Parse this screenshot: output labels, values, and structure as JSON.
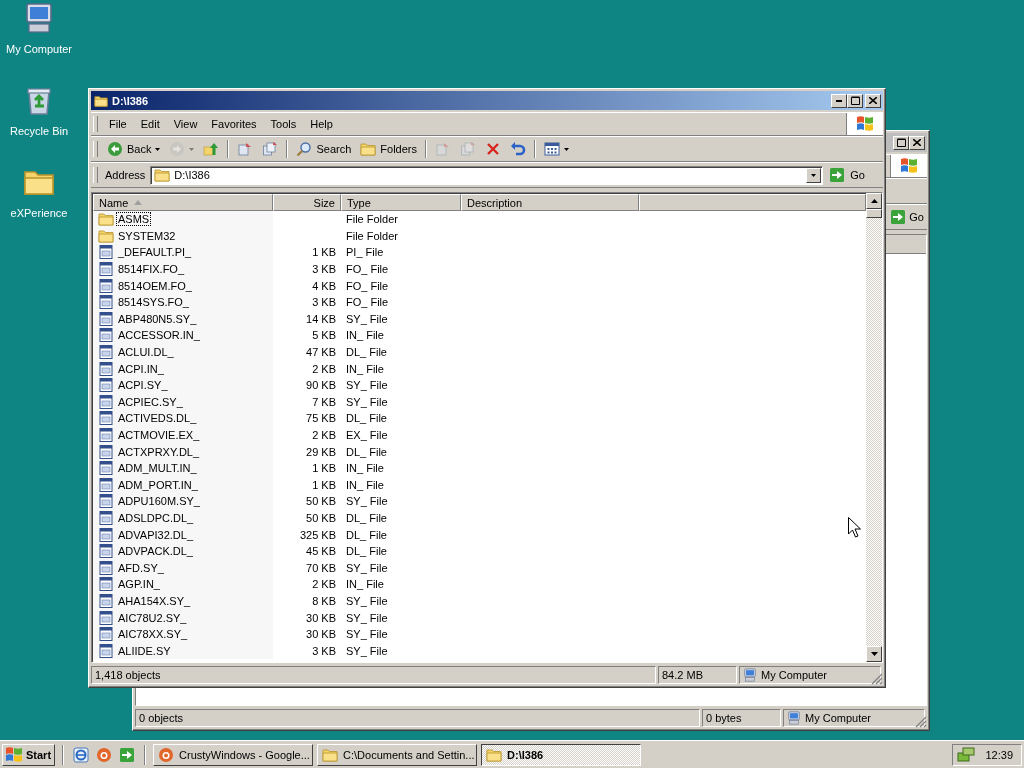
{
  "desktop_icons": [
    {
      "label": "My Computer",
      "kind": "computer"
    },
    {
      "label": "Recycle Bin",
      "kind": "recycle"
    },
    {
      "label": "eXPerience",
      "kind": "folder"
    }
  ],
  "back_window": {
    "go": "Go",
    "status_bar": {
      "objects": "0 objects",
      "size": "0 bytes",
      "zone": "My Computer"
    }
  },
  "window": {
    "title": "D:\\I386",
    "menu": [
      "File",
      "Edit",
      "View",
      "Favorites",
      "Tools",
      "Help"
    ],
    "toolbar": [
      {
        "kind": "back",
        "label": "Back",
        "disabled": false
      },
      {
        "kind": "forward",
        "disabled": true
      },
      {
        "kind": "up",
        "disabled": false
      },
      {
        "kind": "move",
        "disabled": false
      },
      {
        "kind": "copy",
        "disabled": false
      },
      {
        "kind": "search",
        "label": "Search",
        "disabled": false
      },
      {
        "kind": "folders",
        "label": "Folders",
        "disabled": false
      },
      {
        "kind": "move",
        "disabled": true
      },
      {
        "kind": "copy",
        "disabled": true
      },
      {
        "kind": "delete",
        "disabled": false
      },
      {
        "kind": "undo",
        "disabled": false
      },
      {
        "kind": "views",
        "disabled": false
      }
    ],
    "address": {
      "label": "Address",
      "value": "D:\\I386",
      "go": "Go"
    },
    "columns": [
      {
        "label": "Name",
        "sorted": true
      },
      {
        "label": "Size",
        "sorted": false
      },
      {
        "label": "Type",
        "sorted": false
      },
      {
        "label": "Description",
        "sorted": false
      }
    ],
    "rows": [
      {
        "kind": "folder",
        "name": "ASMS",
        "size": "",
        "type": "File Folder",
        "focused": true
      },
      {
        "kind": "folder",
        "name": "SYSTEM32",
        "size": "",
        "type": "File Folder",
        "focused": false
      },
      {
        "kind": "file",
        "name": "_DEFAULT.PI_",
        "size": "1 KB",
        "type": "PI_ File",
        "focused": false
      },
      {
        "kind": "file",
        "name": "8514FIX.FO_",
        "size": "3 KB",
        "type": "FO_ File",
        "focused": false
      },
      {
        "kind": "file",
        "name": "8514OEM.FO_",
        "size": "4 KB",
        "type": "FO_ File",
        "focused": false
      },
      {
        "kind": "file",
        "name": "8514SYS.FO_",
        "size": "3 KB",
        "type": "FO_ File",
        "focused": false
      },
      {
        "kind": "file",
        "name": "ABP480N5.SY_",
        "size": "14 KB",
        "type": "SY_ File",
        "focused": false
      },
      {
        "kind": "file",
        "name": "ACCESSOR.IN_",
        "size": "5 KB",
        "type": "IN_ File",
        "focused": false
      },
      {
        "kind": "file",
        "name": "ACLUI.DL_",
        "size": "47 KB",
        "type": "DL_ File",
        "focused": false
      },
      {
        "kind": "file",
        "name": "ACPI.IN_",
        "size": "2 KB",
        "type": "IN_ File",
        "focused": false
      },
      {
        "kind": "file",
        "name": "ACPI.SY_",
        "size": "90 KB",
        "type": "SY_ File",
        "focused": false
      },
      {
        "kind": "file",
        "name": "ACPIEC.SY_",
        "size": "7 KB",
        "type": "SY_ File",
        "focused": false
      },
      {
        "kind": "file",
        "name": "ACTIVEDS.DL_",
        "size": "75 KB",
        "type": "DL_ File",
        "focused": false
      },
      {
        "kind": "file",
        "name": "ACTMOVIE.EX_",
        "size": "2 KB",
        "type": "EX_ File",
        "focused": false
      },
      {
        "kind": "file",
        "name": "ACTXPRXY.DL_",
        "size": "29 KB",
        "type": "DL_ File",
        "focused": false
      },
      {
        "kind": "file",
        "name": "ADM_MULT.IN_",
        "size": "1 KB",
        "type": "IN_ File",
        "focused": false
      },
      {
        "kind": "file",
        "name": "ADM_PORT.IN_",
        "size": "1 KB",
        "type": "IN_ File",
        "focused": false
      },
      {
        "kind": "file",
        "name": "ADPU160M.SY_",
        "size": "50 KB",
        "type": "SY_ File",
        "focused": false
      },
      {
        "kind": "file",
        "name": "ADSLDPC.DL_",
        "size": "50 KB",
        "type": "DL_ File",
        "focused": false
      },
      {
        "kind": "file",
        "name": "ADVAPI32.DL_",
        "size": "325 KB",
        "type": "DL_ File",
        "focused": false
      },
      {
        "kind": "file",
        "name": "ADVPACK.DL_",
        "size": "45 KB",
        "type": "DL_ File",
        "focused": false
      },
      {
        "kind": "file",
        "name": "AFD.SY_",
        "size": "70 KB",
        "type": "SY_ File",
        "focused": false
      },
      {
        "kind": "file",
        "name": "AGP.IN_",
        "size": "2 KB",
        "type": "IN_ File",
        "focused": false
      },
      {
        "kind": "file",
        "name": "AHA154X.SY_",
        "size": "8 KB",
        "type": "SY_ File",
        "focused": false
      },
      {
        "kind": "file",
        "name": "AIC78U2.SY_",
        "size": "30 KB",
        "type": "SY_ File",
        "focused": false
      },
      {
        "kind": "file",
        "name": "AIC78XX.SY_",
        "size": "30 KB",
        "type": "SY_ File",
        "focused": false
      },
      {
        "kind": "file",
        "name": "ALIIDE.SY",
        "size": "3 KB",
        "type": "SY_ File",
        "focused": false
      }
    ],
    "status_bar": {
      "objects": "1,418 objects",
      "size": "84.2 MB",
      "zone": "My Computer"
    }
  },
  "taskbar": {
    "start": "Start",
    "quick_launch": [
      {
        "kind": "browser"
      },
      {
        "kind": "app"
      },
      {
        "kind": "arrow"
      }
    ],
    "tasks": [
      {
        "kind": "app",
        "label": "CrustyWindows - Google...",
        "selected": false
      },
      {
        "kind": "folder",
        "label": "C:\\Documents and Settin...",
        "selected": false
      },
      {
        "kind": "folder",
        "label": "D:\\I386",
        "selected": true
      }
    ],
    "clock": "12:39"
  }
}
